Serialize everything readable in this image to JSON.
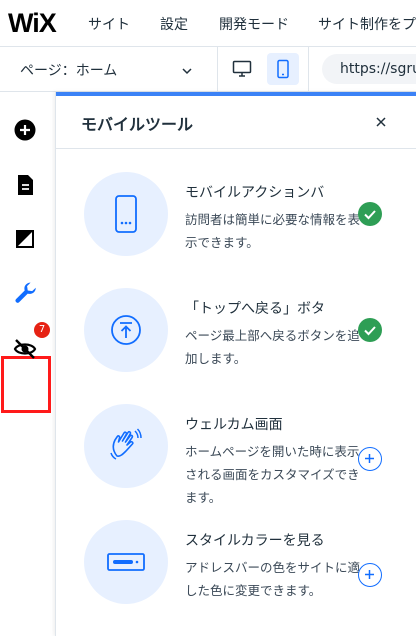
{
  "topbar": {
    "logo": "WiX",
    "menu": [
      "サイト",
      "設定",
      "開発モード",
      "サイト制作をプ"
    ]
  },
  "secondbar": {
    "page_label": "ページ：ホーム",
    "url_prefix": "https://sgru"
  },
  "rail": {
    "badge_count": "7"
  },
  "panel": {
    "title": "モバイルツール",
    "tools": [
      {
        "title": "モバイルアクションバ",
        "description": "訪問者は簡単に必要な情報を表示できます。",
        "status": "enabled"
      },
      {
        "title": "「トップへ戻る」ボタ",
        "description": "ページ最上部へ戻るボタンを追加します。",
        "status": "enabled"
      },
      {
        "title": "ウェルカム画面",
        "description": "ホームページを開いた時に表示される画面をカスタマイズできます。",
        "status": "add"
      },
      {
        "title": "スタイルカラーを見る",
        "description": "アドレスバーの色をサイトに適した色に変更できます。",
        "status": "add"
      }
    ]
  },
  "colors": {
    "accent": "#116dff",
    "panel_top": "#3b82f6",
    "check": "#2e9e55",
    "highlight": "#ff1a1a",
    "badge": "#e62214",
    "circle_bg": "#e7f0ff"
  }
}
